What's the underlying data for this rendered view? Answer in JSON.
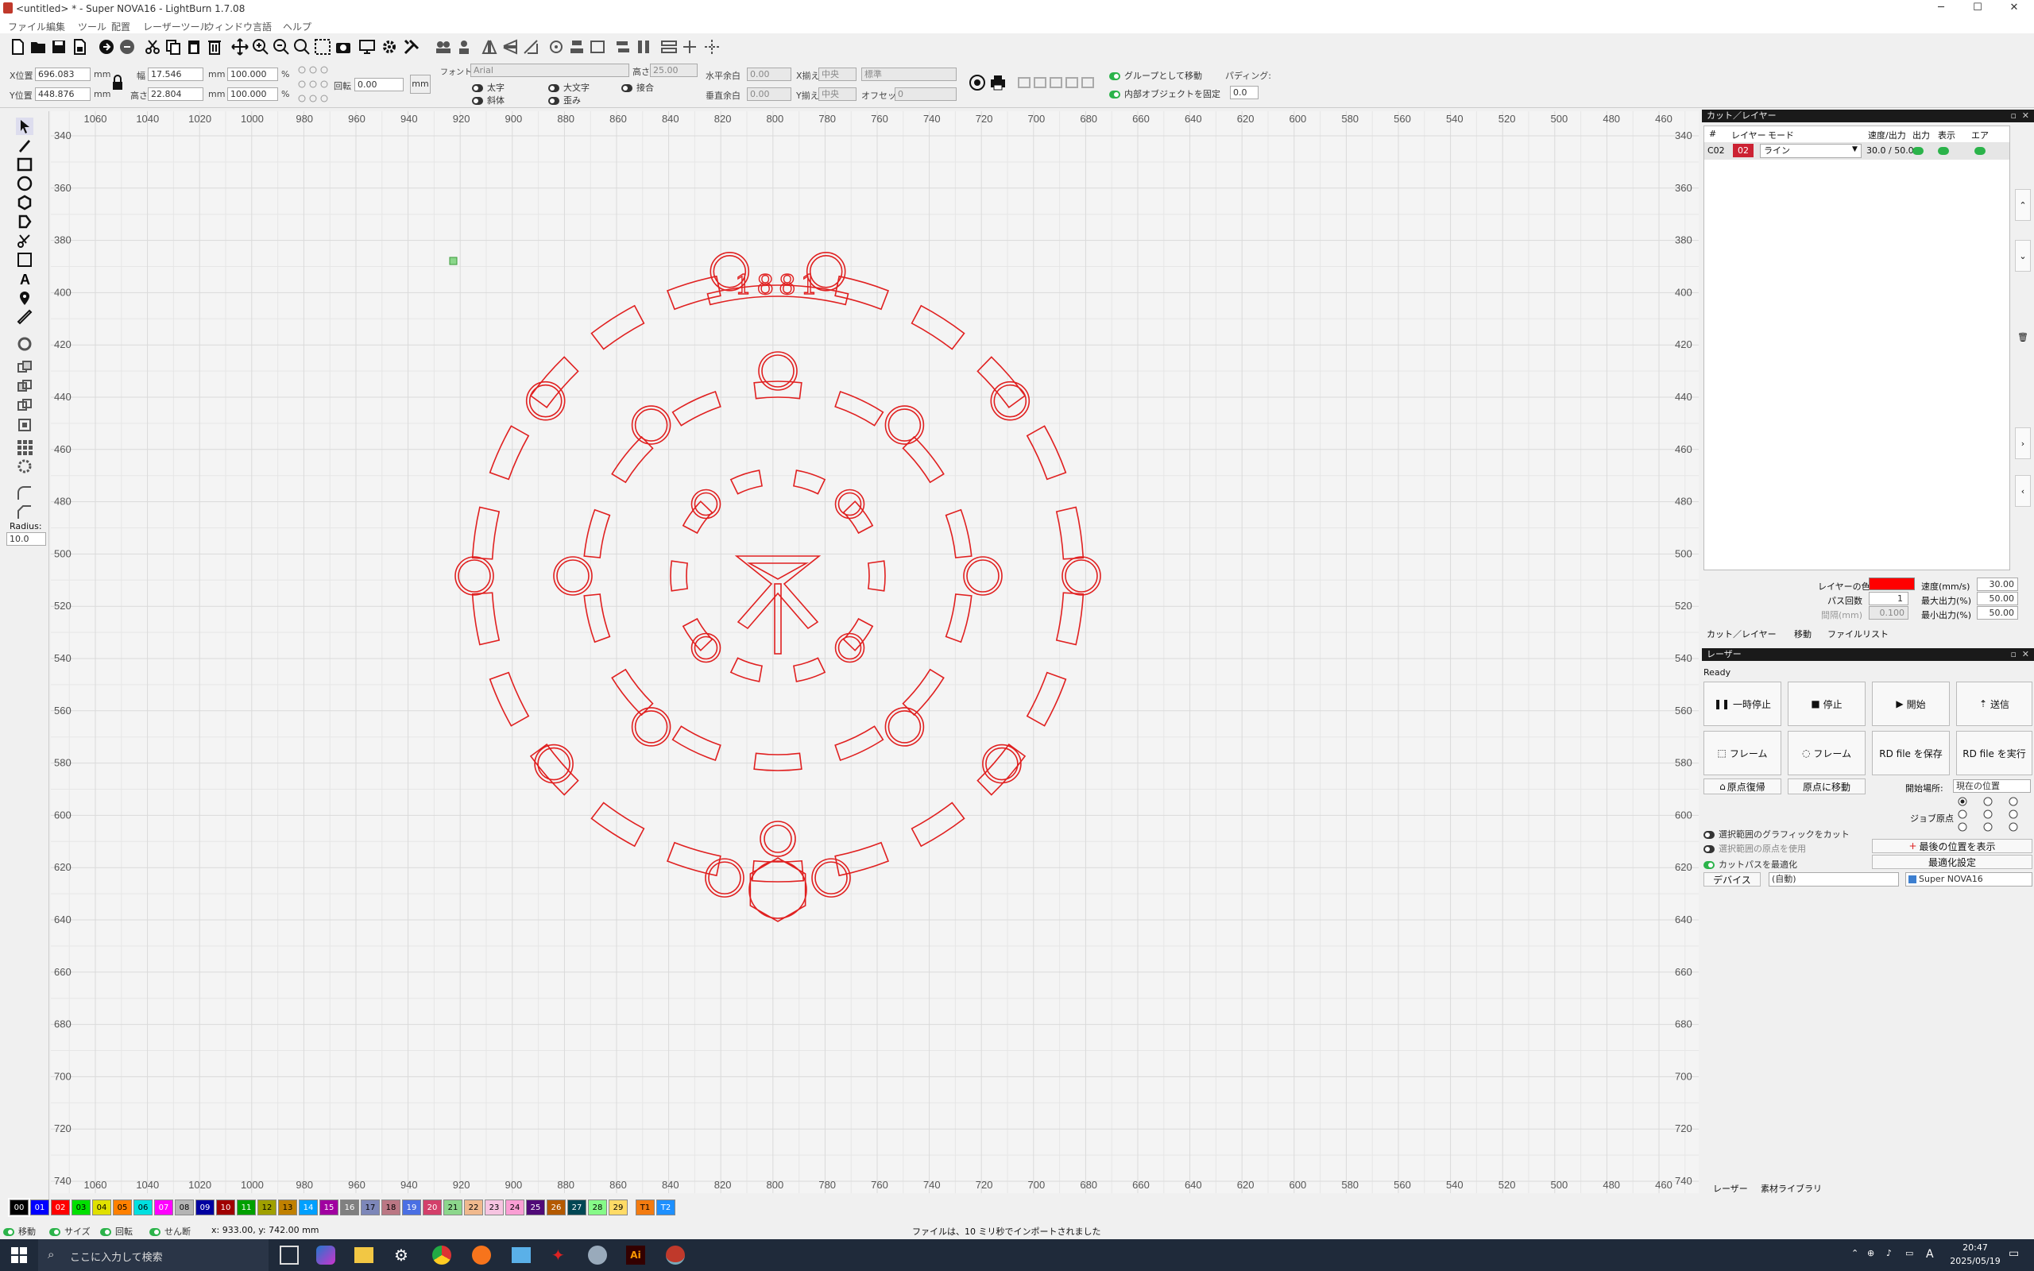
{
  "window": {
    "title": "<untitled> * - Super NOVA16 - LightBurn 1.7.08",
    "minimize": "─",
    "maximize": "☐",
    "close": "✕"
  },
  "menu": [
    "ファイル",
    "編集",
    "ツール",
    "配置",
    "レーザーツール",
    "ウィンドウ",
    "言語",
    "ヘルプ"
  ],
  "props": {
    "x_label": "X位置",
    "x_value": "696.083",
    "y_label": "Y位置",
    "y_value": "448.876",
    "unit_mm": "mm",
    "width_label": "幅",
    "width_value": "17.546",
    "height_label": "高さ",
    "height_value": "22.804",
    "scale_w": "100.000",
    "scale_h": "100.000",
    "percent": "%",
    "rotate_label": "回転",
    "rotate_value": "0.00",
    "mm_button": "mm",
    "font_label": "フォント",
    "font_value": "Arial",
    "height2_label": "高さ",
    "height2_value": "25.00",
    "bold": "太字",
    "italic": "斜体",
    "upper": "大文字",
    "distort": "歪み",
    "weld": "接合",
    "hspace_label": "水平余白",
    "hspace_value": "0.00",
    "vspace_label": "垂直余白",
    "vspace_value": "0.00",
    "xalign_label": "X揃え",
    "xalign_value": "中央",
    "yalign_label": "Y揃え",
    "yalign_value": "中央",
    "mode_value": "標準",
    "offset_label": "オフセット",
    "offset_value": "0",
    "group_move": "グループとして移動",
    "lock_inner": "内部オブジェクトを固定",
    "padding_label": "パディング:",
    "padding_value": "0.0"
  },
  "left": {
    "radius_label": "Radius:",
    "radius_value": "10.0"
  },
  "rulers": {
    "top": [
      "1060",
      "1040",
      "1020",
      "1000",
      "980",
      "960",
      "940",
      "920",
      "900",
      "880",
      "860",
      "840",
      "820",
      "800",
      "780",
      "760",
      "740",
      "720",
      "700",
      "680",
      "660",
      "640",
      "620",
      "600",
      "580",
      "560",
      "540",
      "520",
      "500",
      "480",
      "460"
    ],
    "side": [
      "340",
      "360",
      "380",
      "400",
      "420",
      "440",
      "460",
      "480",
      "500",
      "520",
      "540",
      "560",
      "580",
      "600",
      "620",
      "640",
      "660",
      "680",
      "700",
      "720",
      "740"
    ]
  },
  "artwork": {
    "top_text": "1881",
    "stroke_color": "#e02020"
  },
  "cut_panel": {
    "title": "カット／レイヤー",
    "col_num": "#",
    "col_layer": "レイヤー",
    "col_mode": "モード",
    "col_speed": "速度/出力",
    "col_output": "出力",
    "col_show": "表示",
    "col_air": "エア",
    "row_id": "C02",
    "row_layer": "02",
    "row_mode": "ライン",
    "row_speed": "30.0 / 50.0",
    "layer_color_label": "レイヤーの色",
    "layer_color": "#ff0000",
    "speed_label": "速度(mm/s)",
    "speed_value": "30.00",
    "pass_label": "パス回数",
    "pass_value": "1",
    "maxpow_label": "最大出力(%)",
    "maxpow_value": "50.00",
    "interval_label": "間隔(mm)",
    "interval_value": "0.100",
    "minpow_label": "最小出力(%)",
    "minpow_value": "50.00",
    "tabs": [
      "カット／レイヤー",
      "移動",
      "ファイルリスト"
    ]
  },
  "laser_panel": {
    "title": "レーザー",
    "status": "Ready",
    "pause": "一時停止",
    "stop": "停止",
    "start": "開始",
    "send": "送信",
    "frame1": "フレーム",
    "frame2": "フレーム",
    "save_rd": "RD file を保存",
    "run_rd": "RD file を実行",
    "home": "原点復帰",
    "goto_origin": "原点に移動",
    "start_from_label": "開始場所:",
    "start_from_value": "現在の位置",
    "job_origin_label": "ジョブ原点",
    "cut_selected": "選択範囲のグラフィックをカット",
    "use_selection_origin": "選択範囲の原点を使用",
    "optimize_path": "カットパスを最適化",
    "show_last_pos": "最後の位置を表示",
    "optimize_settings": "最適化設定",
    "device_btn": "デバイス",
    "device_value": "(自動)",
    "machine_value": "Super NOVA16",
    "tabs": [
      "レーザー",
      "素材ライブラリ"
    ]
  },
  "palette": [
    {
      "label": "00",
      "color": "#000000",
      "text": "#ffffff"
    },
    {
      "label": "01",
      "color": "#0000ff",
      "text": "#ffffff"
    },
    {
      "label": "02",
      "color": "#ff0000",
      "text": "#ffffff"
    },
    {
      "label": "03",
      "color": "#00e000",
      "text": "#000000"
    },
    {
      "label": "04",
      "color": "#e0e000",
      "text": "#000000"
    },
    {
      "label": "05",
      "color": "#ff8000",
      "text": "#000000"
    },
    {
      "label": "06",
      "color": "#00e0e0",
      "text": "#000000"
    },
    {
      "label": "07",
      "color": "#ff00ff",
      "text": "#ffffff"
    },
    {
      "label": "08",
      "color": "#b4b4b4",
      "text": "#000000"
    },
    {
      "label": "09",
      "color": "#0000a0",
      "text": "#ffffff"
    },
    {
      "label": "10",
      "color": "#a00000",
      "text": "#ffffff"
    },
    {
      "label": "11",
      "color": "#00a000",
      "text": "#ffffff"
    },
    {
      "label": "12",
      "color": "#a0a000",
      "text": "#000000"
    },
    {
      "label": "13",
      "color": "#c08000",
      "text": "#000000"
    },
    {
      "label": "14",
      "color": "#00a0ff",
      "text": "#ffffff"
    },
    {
      "label": "15",
      "color": "#a000a0",
      "text": "#ffffff"
    },
    {
      "label": "16",
      "color": "#808080",
      "text": "#ffffff"
    },
    {
      "label": "17",
      "color": "#7d87b9",
      "text": "#000000"
    },
    {
      "label": "18",
      "color": "#bb7784",
      "text": "#000000"
    },
    {
      "label": "19",
      "color": "#4a6fe3",
      "text": "#ffffff"
    },
    {
      "label": "20",
      "color": "#d33f6a",
      "text": "#ffffff"
    },
    {
      "label": "21",
      "color": "#8cd78c",
      "text": "#000000"
    },
    {
      "label": "22",
      "color": "#f0b98d",
      "text": "#000000"
    },
    {
      "label": "23",
      "color": "#f6c4e1",
      "text": "#000000"
    },
    {
      "label": "24",
      "color": "#fa9ed4",
      "text": "#000000"
    },
    {
      "label": "25",
      "color": "#500a78",
      "text": "#ffffff"
    },
    {
      "label": "26",
      "color": "#b45a00",
      "text": "#ffffff"
    },
    {
      "label": "27",
      "color": "#004754",
      "text": "#ffffff"
    },
    {
      "label": "28",
      "color": "#86fa88",
      "text": "#000000"
    },
    {
      "label": "29",
      "color": "#ffdb66",
      "text": "#000000"
    },
    {
      "label": "T1",
      "color": "#f37b10",
      "text": "#000000"
    },
    {
      "label": "T2",
      "color": "#1e90ff",
      "text": "#ffffff"
    }
  ],
  "status": {
    "move": "移動",
    "size": "サイズ",
    "rotate": "回転",
    "shear": "せん断",
    "coords": "x: 933.00, y: 742.00 mm",
    "message": "ファイルは、10 ミリ秒でインポートされました"
  },
  "taskbar": {
    "search_placeholder": "ここに入力して検索",
    "time": "20:47",
    "date": "2025/05/19",
    "ime": "A"
  }
}
